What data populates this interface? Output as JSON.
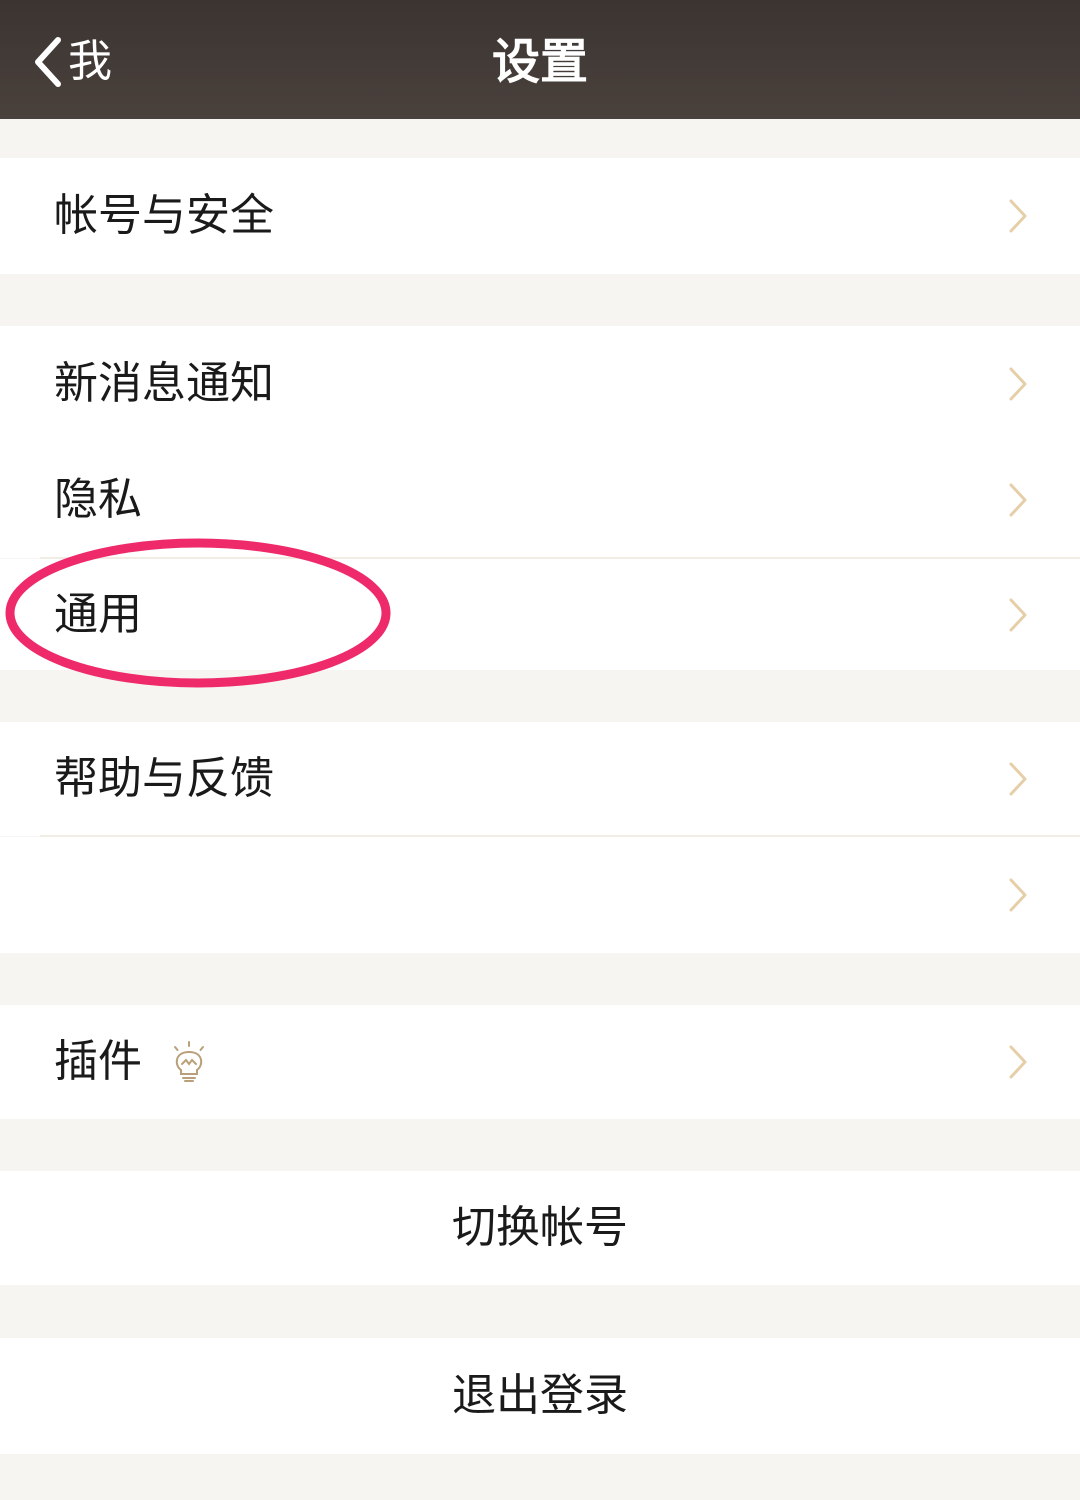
{
  "navbar": {
    "back_label": "我",
    "title": "设置"
  },
  "sections": {
    "account_security": {
      "label": "帐号与安全"
    },
    "new_message_notify": {
      "label": "新消息通知"
    },
    "privacy": {
      "label": "隐私"
    },
    "general": {
      "label": "通用"
    },
    "help_feedback": {
      "label": "帮助与反馈"
    },
    "unlabeled_item": {
      "label": ""
    },
    "plugins": {
      "label": "插件"
    }
  },
  "actions": {
    "switch_account": "切换帐号",
    "logout": "退出登录"
  },
  "icons": {
    "back": "chevron-left-icon",
    "row_arrow": "chevron-right-icon",
    "plugin": "lightbulb-icon"
  },
  "colors": {
    "navbar_bg": "#3f3733",
    "page_bg": "#f7f5f2",
    "row_bg": "#ffffff",
    "chevron": "#e6cfa8",
    "divider": "#f1ece4",
    "highlight_circle": "#ee2a6b",
    "plugin_icon": "#b9a07a"
  }
}
